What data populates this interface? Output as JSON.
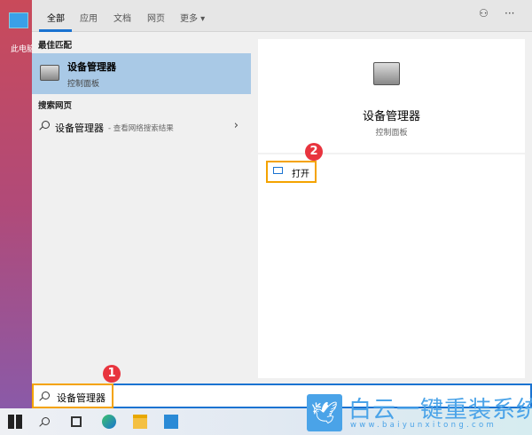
{
  "desktop": {
    "icon_label": "此电脑"
  },
  "tabs": [
    {
      "label": "全部",
      "active": true
    },
    {
      "label": "应用"
    },
    {
      "label": "文档"
    },
    {
      "label": "网页"
    },
    {
      "label": "更多 ▾"
    }
  ],
  "top_icons": {
    "feedback": "feedback-icon",
    "more": "···"
  },
  "left": {
    "best_match_header": "最佳匹配",
    "best_match": {
      "title": "设备管理器",
      "subtitle": "控制面板"
    },
    "web_header": "搜索网页",
    "web_item": {
      "query": "设备管理器",
      "desc": "- 查看网络搜索结果",
      "chevron": "›"
    }
  },
  "right": {
    "title": "设备管理器",
    "subtitle": "控制面板",
    "open_label": "打开"
  },
  "badges": {
    "one": "1",
    "two": "2"
  },
  "search": {
    "value": "设备管理器"
  },
  "watermark": {
    "text": "白云一键重装系统",
    "url": "www.baiyunxitong.com"
  },
  "colors": {
    "accent": "#1a73d1",
    "highlight": "#f4a300",
    "badge": "#e8343e",
    "selected": "#a9c9e6"
  }
}
